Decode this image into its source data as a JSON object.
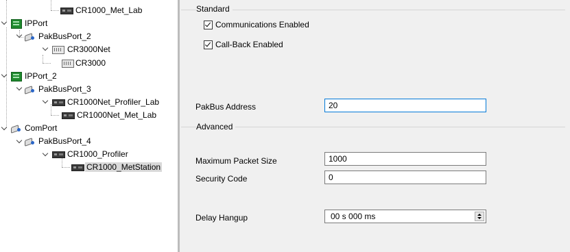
{
  "tree": {
    "items": [
      {
        "label": "CR1000_Met_Lab"
      },
      {
        "label": "IPPort"
      },
      {
        "label": "PakBusPort_2"
      },
      {
        "label": "CR3000Net"
      },
      {
        "label": "CR3000"
      },
      {
        "label": "IPPort_2"
      },
      {
        "label": "PakBusPort_3"
      },
      {
        "label": "CR1000Net_Profiler_Lab"
      },
      {
        "label": "CR1000Net_Met_Lab"
      },
      {
        "label": "ComPort"
      },
      {
        "label": "PakBusPort_4"
      },
      {
        "label": "CR1000_Profiler"
      },
      {
        "label": "CR1000_MetStation"
      }
    ]
  },
  "settings": {
    "standard": {
      "title": "Standard",
      "comm_enabled_label": "Communications Enabled",
      "comm_enabled": true,
      "callback_label": "Call-Back Enabled",
      "callback": true
    },
    "pakbus_address_label": "PakBus Address",
    "pakbus_address": "20",
    "advanced": {
      "title": "Advanced",
      "max_packet_label": "Maximum Packet Size",
      "max_packet": "1000",
      "security_label": "Security Code",
      "security": "0",
      "delay_label": "Delay Hangup",
      "delay": "00 s 000 ms"
    }
  }
}
